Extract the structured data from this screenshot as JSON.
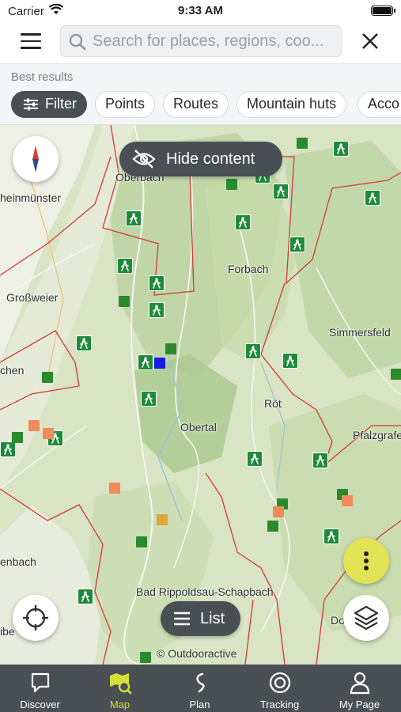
{
  "status_bar": {
    "carrier": "Carrier",
    "time": "9:33 AM"
  },
  "search": {
    "placeholder": "Search for places, regions, coo..."
  },
  "filters": {
    "heading": "Best results",
    "chips": [
      "Filter",
      "Points",
      "Routes",
      "Mountain huts",
      "Acco"
    ]
  },
  "map": {
    "places": [
      "heinmünster",
      "Großweier",
      "chen",
      "Forbach",
      "Simmersfeld",
      "Röt",
      "Obertal",
      "Pfalzgrafen",
      "enbach",
      "Bad Rippoldsau-Schapbach",
      "Do",
      "ibe",
      "Oberbach"
    ],
    "hide_content_label": "Hide content",
    "list_label": "List",
    "attribution": "© Outdooractive",
    "marker_colors": {
      "hiking": "#1f8a3a",
      "point": "#2a8a2e",
      "orange": "#f28a5a",
      "gold": "#e0a63a",
      "selected": "#1a1ae6"
    },
    "more_button_color": "#e2e455"
  },
  "tabbar": {
    "tabs": [
      {
        "label": "Discover",
        "icon": "chat-bubble-icon"
      },
      {
        "label": "Map",
        "icon": "map-search-icon",
        "active": true
      },
      {
        "label": "Plan",
        "icon": "route-icon"
      },
      {
        "label": "Tracking",
        "icon": "record-icon"
      },
      {
        "label": "My Page",
        "icon": "person-icon"
      }
    ],
    "active_color": "#d6df3a"
  }
}
